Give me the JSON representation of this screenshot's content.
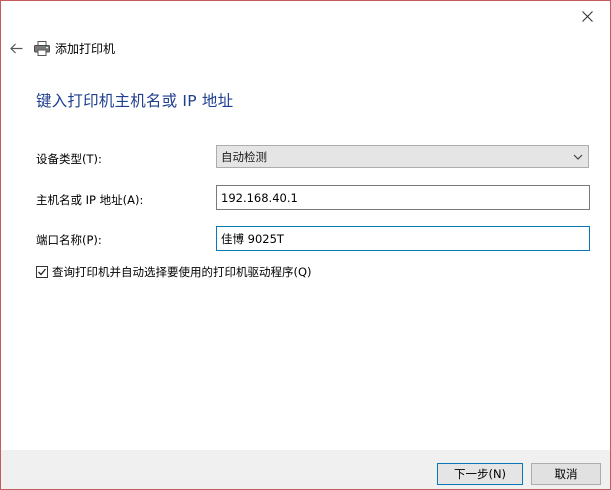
{
  "window": {
    "title": "添加打印机"
  },
  "main": {
    "heading": "键入打印机主机名或 IP 地址"
  },
  "form": {
    "device_type": {
      "label": "设备类型(T):",
      "selected": "自动检测"
    },
    "host": {
      "label": "主机名或 IP 地址(A):",
      "value": "192.168.40.1"
    },
    "port": {
      "label": "端口名称(P):",
      "value": "佳博 9025T"
    },
    "query_checkbox": {
      "label": "查询打印机并自动选择要使用的打印机驱动程序(Q)",
      "checked": true
    }
  },
  "footer": {
    "next_label": "下一步(N)",
    "cancel_label": "取消"
  },
  "colors": {
    "heading": "#1f3f8f",
    "focus_border": "#0a78b4",
    "window_border": "#c65b5b"
  }
}
